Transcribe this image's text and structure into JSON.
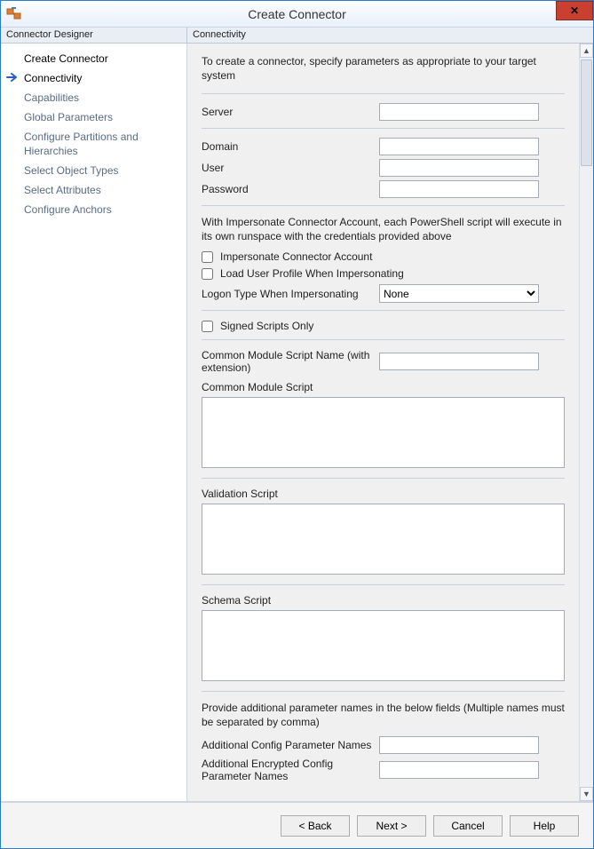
{
  "window": {
    "title": "Create Connector"
  },
  "headers": {
    "left": "Connector Designer",
    "right": "Connectivity"
  },
  "sidebar": {
    "items": [
      {
        "label": "Create Connector"
      },
      {
        "label": "Connectivity"
      },
      {
        "label": "Capabilities"
      },
      {
        "label": "Global Parameters"
      },
      {
        "label": "Configure Partitions and Hierarchies"
      },
      {
        "label": "Select Object Types"
      },
      {
        "label": "Select Attributes"
      },
      {
        "label": "Configure Anchors"
      }
    ]
  },
  "content": {
    "intro": "To create a connector, specify parameters as appropriate to your target system",
    "server_label": "Server",
    "server_value": "",
    "domain_label": "Domain",
    "domain_value": "",
    "user_label": "User",
    "user_value": "",
    "password_label": "Password",
    "password_value": "",
    "impersonate_note": "With Impersonate Connector Account, each PowerShell script will execute in its own runspace with the credentials provided above",
    "impersonate_cb": "Impersonate Connector Account",
    "load_profile_cb": "Load User Profile When Impersonating",
    "logon_type_label": "Logon Type When Impersonating",
    "logon_type_value": "None",
    "signed_scripts_cb": "Signed Scripts Only",
    "common_module_name_label": "Common Module Script Name (with extension)",
    "common_module_name_value": "",
    "common_module_script_label": "Common Module Script",
    "common_module_script_value": "",
    "validation_script_label": "Validation Script",
    "validation_script_value": "",
    "schema_script_label": "Schema Script",
    "schema_script_value": "",
    "additional_note": "Provide additional parameter names in the below fields (Multiple names must be separated by comma)",
    "additional_config_label": "Additional Config Parameter Names",
    "additional_config_value": "",
    "additional_enc_config_label": "Additional Encrypted Config Parameter Names",
    "additional_enc_config_value": ""
  },
  "footer": {
    "back": "<  Back",
    "next": "Next  >",
    "cancel": "Cancel",
    "help": "Help"
  }
}
